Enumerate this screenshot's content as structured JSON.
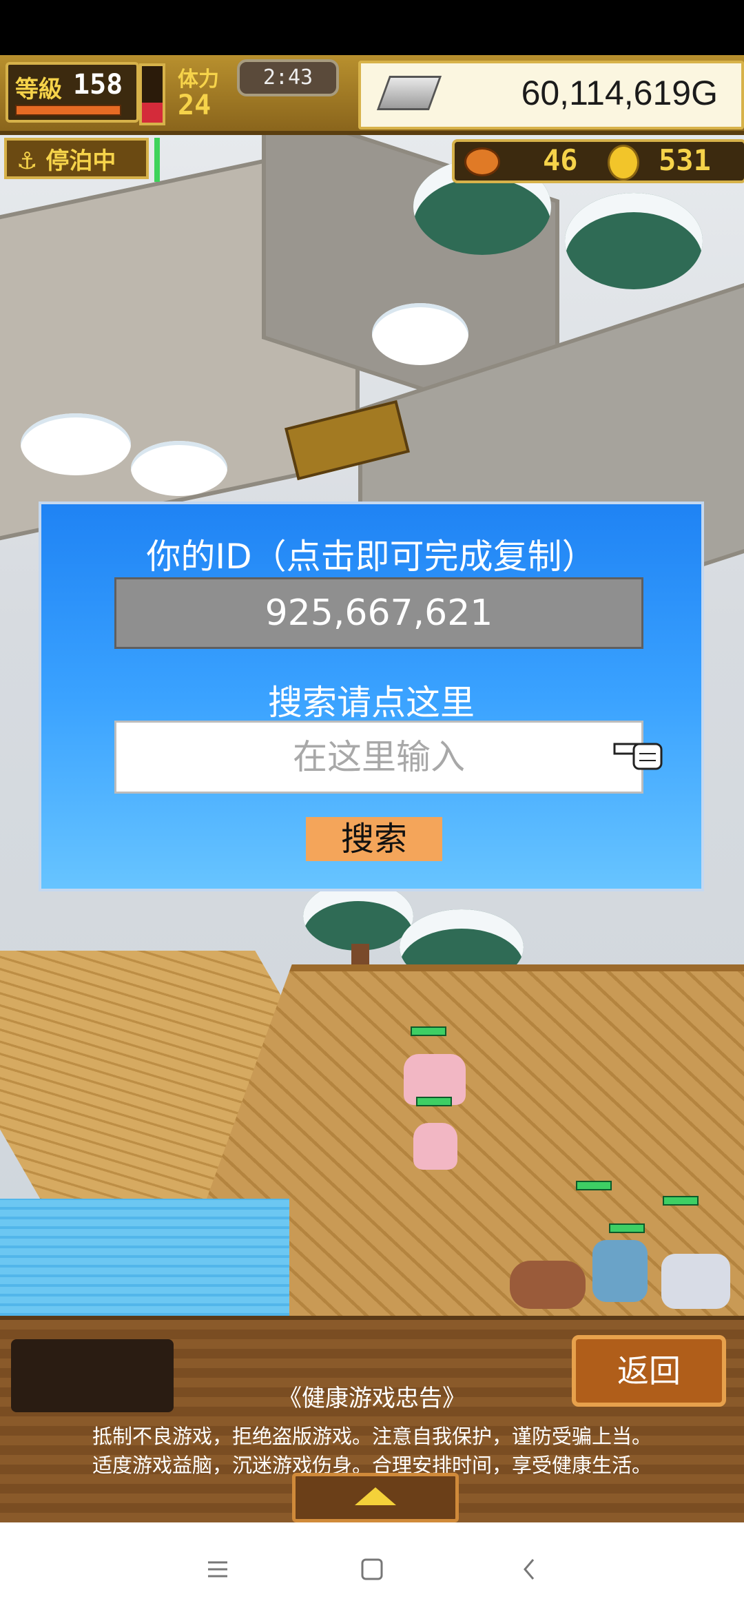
{
  "hud": {
    "level_label": "等級",
    "level": "158",
    "stamina_label": "体力",
    "stamina": "24",
    "stamina_fill_fraction": 0.35,
    "timer": "2:43",
    "gold": "60,114,619G",
    "status": "停泊中",
    "jar_count": "46",
    "coin_count": "531"
  },
  "dialog": {
    "title": "你的ID（点击即可完成复制）",
    "id_value": "925,667,621",
    "search_prompt": "搜索请点这里",
    "search_placeholder": "在这里输入",
    "search_button": "搜索"
  },
  "bottom": {
    "back_button": "返回",
    "notice_title": "《健康游戏忠告》",
    "notice_line1": "抵制不良游戏，拒绝盗版游戏。注意自我保护，谨防受骗上当。",
    "notice_line2": "适度游戏益脑，沉迷游戏伤身。合理安排时间，享受健康生活。"
  },
  "nav": {
    "icons": [
      "menu-icon",
      "home-square-icon",
      "back-chevron-icon"
    ]
  },
  "colors": {
    "dialog_top": "#1f83f4",
    "dialog_bottom": "#67c4ff",
    "search_button": "#f4a55a",
    "hud_gold": "#f6d34a"
  }
}
